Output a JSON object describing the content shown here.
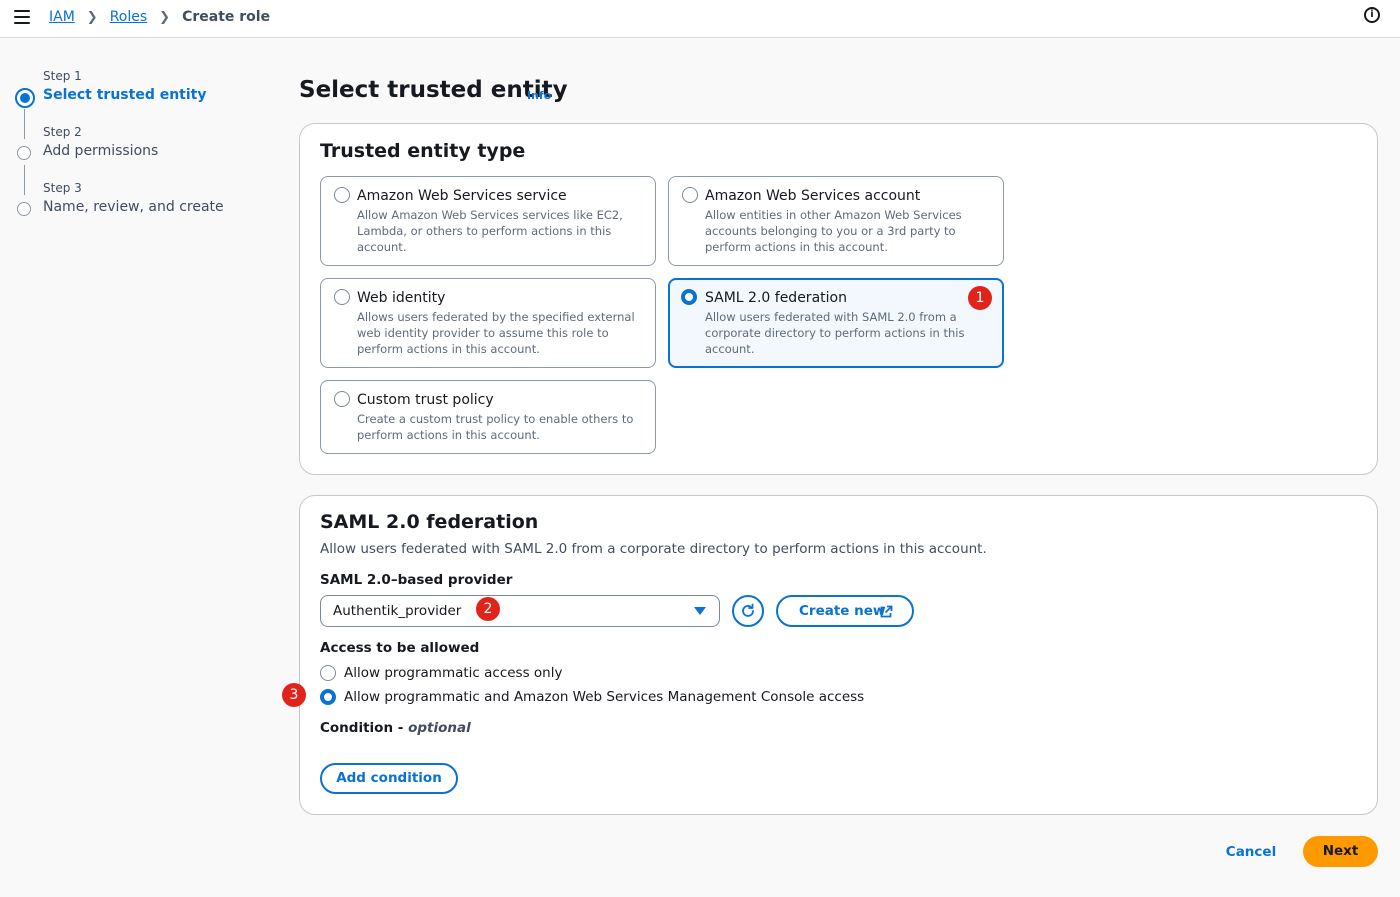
{
  "breadcrumb": {
    "items": [
      "IAM",
      "Roles"
    ],
    "current": "Create role"
  },
  "steps": [
    {
      "num": "Step 1",
      "label": "Select trusted entity",
      "active": true
    },
    {
      "num": "Step 2",
      "label": "Add permissions",
      "active": false
    },
    {
      "num": "Step 3",
      "label": "Name, review, and create",
      "active": false
    }
  ],
  "page": {
    "title": "Select trusted entity",
    "info_link": "Info"
  },
  "trusted_entity": {
    "heading": "Trusted entity type",
    "options": [
      {
        "title": "Amazon Web Services service",
        "desc": "Allow Amazon Web Services services like EC2, Lambda, or others to perform actions in this account.",
        "selected": false
      },
      {
        "title": "Amazon Web Services account",
        "desc": "Allow entities in other Amazon Web Services accounts belonging to you or a 3rd party to perform actions in this account.",
        "selected": false
      },
      {
        "title": "Web identity",
        "desc": "Allows users federated by the specified external web identity provider to assume this role to perform actions in this account.",
        "selected": false
      },
      {
        "title": "SAML 2.0 federation",
        "desc": "Allow users federated with SAML 2.0 from a corporate directory to perform actions in this account.",
        "selected": true
      },
      {
        "title": "Custom trust policy",
        "desc": "Create a custom trust policy to enable others to perform actions in this account.",
        "selected": false
      }
    ]
  },
  "saml": {
    "heading": "SAML 2.0 federation",
    "description": "Allow users federated with SAML 2.0 from a corporate directory to perform actions in this account.",
    "provider_label": "SAML 2.0–based provider",
    "provider_value": "Authentik_provider",
    "create_new_label": "Create new",
    "access_label": "Access to be allowed",
    "access_options": [
      {
        "label": "Allow programmatic access only",
        "selected": false
      },
      {
        "label": "Allow programmatic and Amazon Web Services Management Console access",
        "selected": true
      }
    ],
    "condition_label": "Condition - ",
    "condition_optional": "optional",
    "add_condition_label": "Add condition"
  },
  "footer": {
    "cancel_label": "Cancel",
    "next_label": "Next"
  },
  "annotations": [
    "1",
    "2",
    "3"
  ],
  "colors": {
    "accent": "#0972d3",
    "primary_button": "#ff9900",
    "annotation_badge": "#e0241b",
    "selected_tile_bg": "#f2f8fd"
  }
}
